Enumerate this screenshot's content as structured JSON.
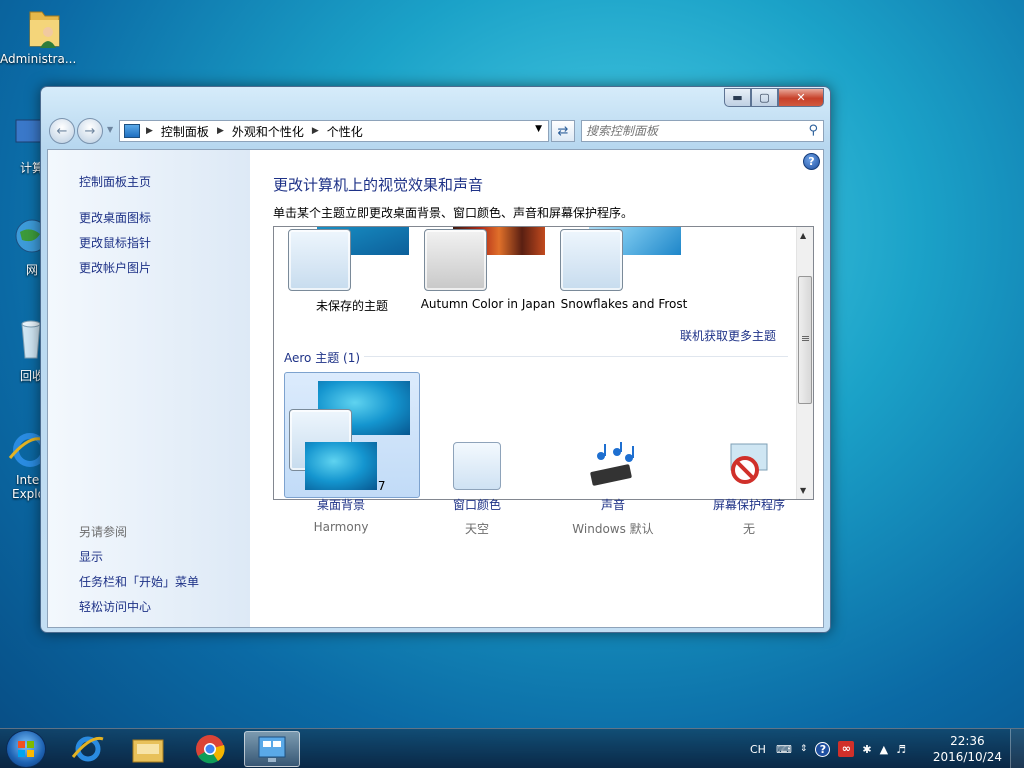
{
  "desktop": {
    "user_folder_label": "Administra...",
    "partial_labels": [
      "计算",
      "网",
      "回收",
      "Inte",
      "Explo"
    ]
  },
  "window": {
    "address": {
      "crumbs": [
        "控制面板",
        "外观和个性化",
        "个性化"
      ]
    },
    "search_placeholder": "搜索控制面板",
    "left_pane": {
      "home": "控制面板主页",
      "links": [
        "更改桌面图标",
        "更改鼠标指针",
        "更改帐户图片"
      ],
      "see_also_title": "另请参阅",
      "see_also": [
        "显示",
        "任务栏和「开始」菜单",
        "轻松访问中心"
      ]
    },
    "main": {
      "title": "更改计算机上的视觉效果和声音",
      "description": "单击某个主题立即更改桌面背景、窗口颜色、声音和屏幕保护程序。",
      "themes": [
        "未保存的主题",
        "Autumn Color in Japan",
        "Snowflakes and Frost"
      ],
      "more_themes_link": "联机获取更多主题",
      "aero_group": "Aero 主题 (1)",
      "aero_themes": [
        "Windows 7"
      ],
      "settings": [
        {
          "label": "桌面背景",
          "value": "Harmony"
        },
        {
          "label": "窗口颜色",
          "value": "天空"
        },
        {
          "label": "声音",
          "value": "Windows 默认"
        },
        {
          "label": "屏幕保护程序",
          "value": "无"
        }
      ]
    }
  },
  "taskbar": {
    "language": "CH",
    "time": "22:36",
    "date": "2016/10/24"
  },
  "colors": {
    "link_blue": "#1e3287",
    "aero_teal": "#1ba2c8"
  }
}
